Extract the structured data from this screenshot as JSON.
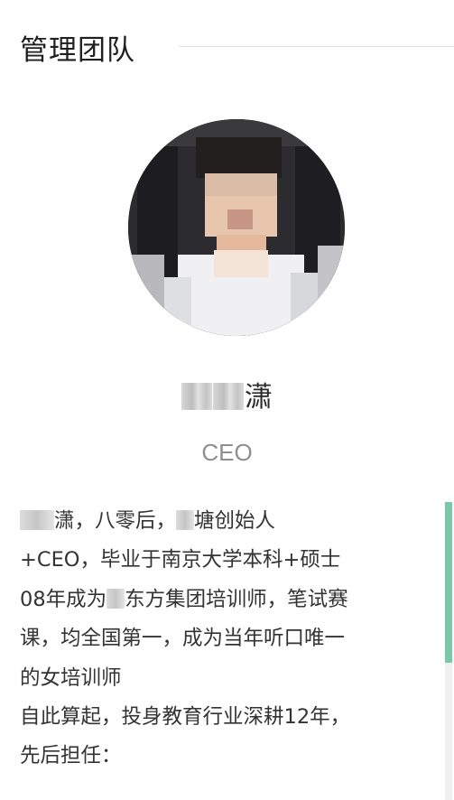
{
  "section": {
    "title": "管理团队"
  },
  "member": {
    "name_visible": "潇",
    "role": "CEO",
    "avatar_icon": "portrait-avatar"
  },
  "bio": {
    "line1_visible_a": "潇，八零后，",
    "line1_visible_b": "塘创始人",
    "line2": "+CEO，毕业于南京大学本科+硕士",
    "line3_a": "08年成为",
    "line3_b": "东方集团培训师，笔试赛",
    "line4": "课，均全国第一，成为当年听口唯一",
    "line5": "的女培训师",
    "line6": "自此算起，投身教育行业深耕12年，",
    "line7": "先后担任："
  },
  "colors": {
    "accent": "#79c8a6",
    "role_text": "#8f8f8f",
    "rule": "#e2e2e2"
  }
}
